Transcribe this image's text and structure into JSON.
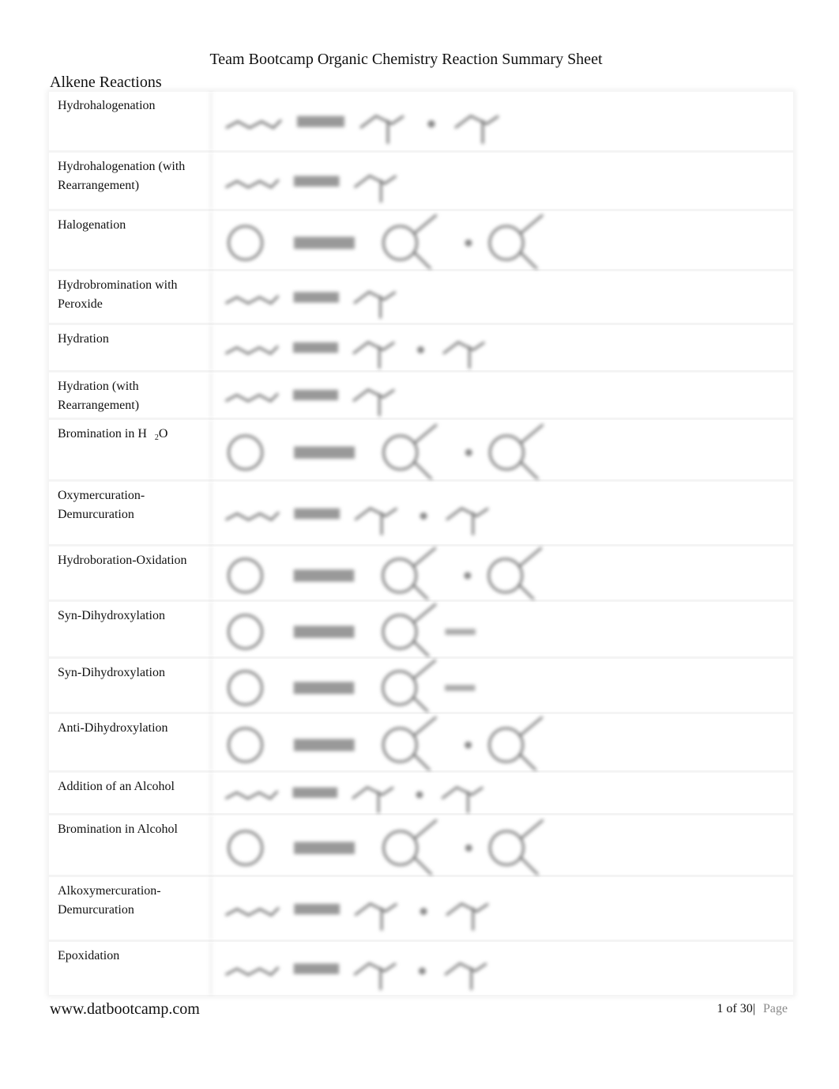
{
  "document": {
    "title": "Team Bootcamp Organic Chemistry Reaction Summary Sheet",
    "section": "Alkene Reactions"
  },
  "reactions": [
    {
      "name": "Hydrohalogenation",
      "scheme": "chain-to-markovnikov-halide-pair"
    },
    {
      "name": "Hydrohalogenation (with Rearrangement)",
      "scheme": "branched-chain-rearranged-halide"
    },
    {
      "name": "Halogenation",
      "scheme": "cycloalkene-to-dihalide-pair"
    },
    {
      "name": "Hydrobromination with Peroxide",
      "scheme": "chain-to-anti-markovnikov-bromide"
    },
    {
      "name": "Hydration",
      "scheme": "chain-to-alcohol-pair"
    },
    {
      "name": "Hydration (with Rearrangement)",
      "scheme": "branched-chain-rearranged-alcohol"
    },
    {
      "name": "Bromination in H",
      "name_sub": "2",
      "name_suffix": "O",
      "scheme": "cycloalkene-to-bromohydrin-pair"
    },
    {
      "name": "Oxymercuration-Demurcuration",
      "scheme": "chain-to-alcohol-pair"
    },
    {
      "name": "Hydroboration-Oxidation",
      "scheme": "cycloalkene-to-alcohol-pair"
    },
    {
      "name": "Syn-Dihydroxylation",
      "scheme": "cycloalkene-to-diol-meso"
    },
    {
      "name": "Syn-Dihydroxylation",
      "scheme": "cycloalkene-to-diol-meso"
    },
    {
      "name": "Anti-Dihydroxylation",
      "scheme": "cycloalkene-to-diol-pair"
    },
    {
      "name": "Addition of an Alcohol",
      "scheme": "chain-to-ether-pair"
    },
    {
      "name": "Bromination in Alcohol",
      "scheme": "cycloalkene-to-bromoether-pair"
    },
    {
      "name": "Alkoxymercuration-Demurcuration",
      "scheme": "chain-to-ether-pair"
    },
    {
      "name": "Epoxidation",
      "scheme": "chain-to-epoxide-pair"
    }
  ],
  "footer": {
    "url": "www.datbootcamp.com",
    "page_number": "1 of 30|",
    "page_label": "Page"
  }
}
